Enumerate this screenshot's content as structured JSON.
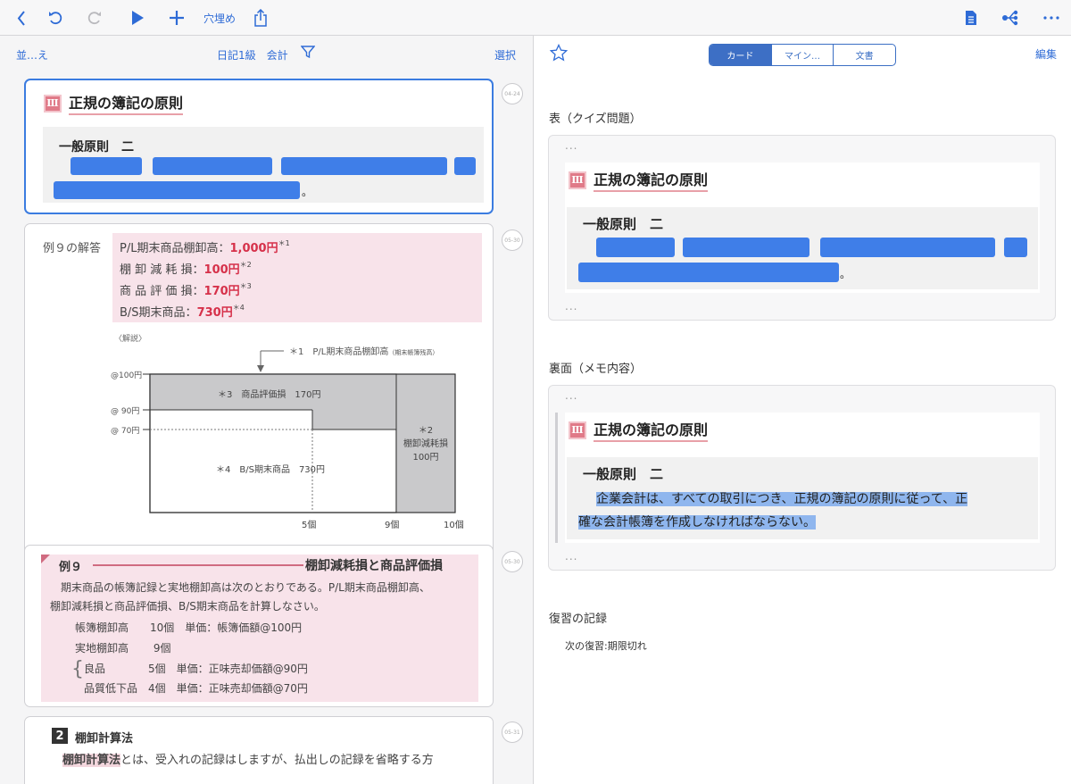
{
  "toolbar": {
    "cloze_label": "穴埋め"
  },
  "list_header": {
    "sort_label": "並…え",
    "filter_tags": "日記1級　会計",
    "select_label": "選択"
  },
  "cards": [
    {
      "date": "04-24",
      "roman": "Ⅲ",
      "title": "正規の簿記の原則",
      "sub": "一般原則　二",
      "tail": "。"
    },
    {
      "date": "05-30",
      "label": "例９の解答",
      "lines": [
        {
          "name": "P/L期末商品棚卸高：",
          "value": "1,000円",
          "mark": "＊1"
        },
        {
          "name": "棚 卸 減 耗 損：",
          "value": "100円",
          "mark": "＊2"
        },
        {
          "name": "商 品 評 価 損：",
          "value": "170円",
          "mark": "＊3"
        },
        {
          "name": "B/S期末商品：",
          "value": "730円",
          "mark": "＊4"
        }
      ],
      "diagram": {
        "caption": "〈解説〉",
        "note1": "＊1　P/L期末商品棚卸高",
        "note1_small": "（期末帳簿残高）",
        "y_labels": [
          "@100円",
          "@ 90円",
          "@ 70円"
        ],
        "x_labels": [
          "5個",
          "9個",
          "10個"
        ],
        "box3": "＊3　商品評価損　170円",
        "box2_l1": "＊2",
        "box2_l2": "棚卸減耗損",
        "box2_l3": "100円",
        "box4": "＊4　B/S期末商品　730円"
      }
    },
    {
      "date": "05-30",
      "ex_no": "例９",
      "ex_title": "棚卸減耗損と商品評価損",
      "body1": "期末商品の帳簿記録と実地棚卸高は次のとおりである。P/L期末商品棚卸高、",
      "body2": "棚卸減耗損と商品評価損、B/S期末商品を計算しなさい。",
      "rows": [
        "帳簿棚卸高　　10個　単価：帳簿価額@100円",
        "実地棚卸高　　 9個",
        "良品　　　　5個　単価：正味売却価額@90円",
        "品質低下品　4個　単価：正味売却価額@70円"
      ]
    },
    {
      "date": "05-31",
      "num": "2",
      "title": "棚卸計算法",
      "body_bold": "棚卸計算法",
      "body_rest": "とは、受入れの記録はしますが、払出しの記録を省略する方"
    }
  ],
  "detail": {
    "segments": [
      "カード",
      "マイン…",
      "文書"
    ],
    "edit_label": "編集",
    "front_label": "表（クイズ問題）",
    "back_label": "裏面（メモ内容）",
    "ellipsis": "...",
    "roman": "Ⅲ",
    "title": "正規の簿記の原則",
    "sub": "一般原則　二",
    "tail": "。",
    "answer_line1": "企業会計は、すべての取引につき、正規の簿記の原則に従って、正",
    "answer_line2": "確な会計帳簿を作成しなければならない。",
    "review_label": "復習の記録",
    "next_review": "次の復習:期限切れ"
  },
  "colors": {
    "accent": "#2e6bd6",
    "mask": "#3f7ee8",
    "pink": "#f8e3ea",
    "red": "#d6314a"
  }
}
